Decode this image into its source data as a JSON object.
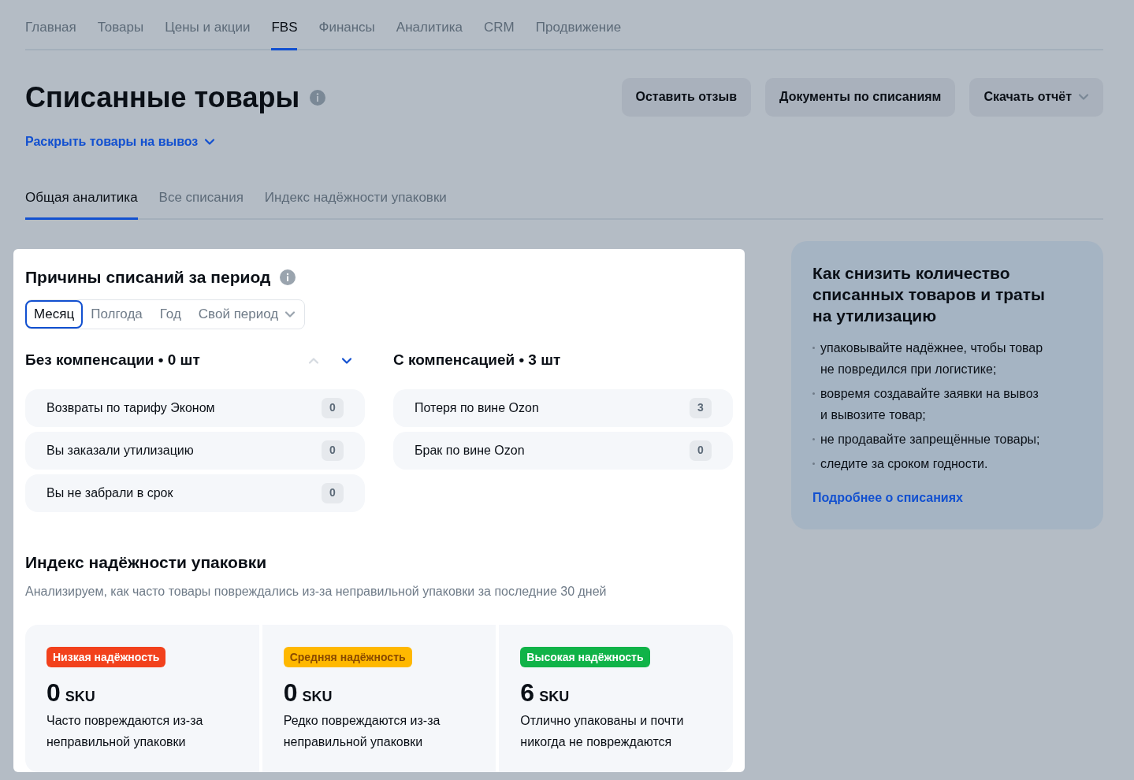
{
  "nav": [
    {
      "label": "Главная",
      "selected": false
    },
    {
      "label": "Товары",
      "selected": false
    },
    {
      "label": "Цены и акции",
      "selected": false
    },
    {
      "label": "FBS",
      "selected": true
    },
    {
      "label": "Финансы",
      "selected": false
    },
    {
      "label": "Аналитика",
      "selected": false
    },
    {
      "label": "CRM",
      "selected": false
    },
    {
      "label": "Продвижение",
      "selected": false
    }
  ],
  "page": {
    "title": "Списанные товары",
    "expand_link": "Раскрыть товары на вывоз"
  },
  "actions": [
    {
      "label": "Оставить отзыв",
      "kind": "plain"
    },
    {
      "label": "Документы по списаниям",
      "kind": "plain"
    },
    {
      "label": "Скачать отчёт",
      "kind": "dropdown"
    }
  ],
  "tabs": [
    {
      "label": "Общая аналитика",
      "selected": true
    },
    {
      "label": "Все списания",
      "selected": false
    },
    {
      "label": "Индекс надёжности упаковки",
      "selected": false
    }
  ],
  "reasons": {
    "title": "Причины списаний за период",
    "periods": [
      {
        "label": "Месяц",
        "selected": true,
        "kind": "plain"
      },
      {
        "label": "Полгода",
        "selected": false,
        "kind": "plain"
      },
      {
        "label": "Год",
        "selected": false,
        "kind": "plain"
      },
      {
        "label": "Свой период",
        "selected": false,
        "kind": "dropdown"
      }
    ],
    "groups": [
      {
        "title": "Без компенсации • 0 шт",
        "pager": true,
        "items": [
          {
            "label": "Возвраты по тарифу Эконом",
            "count": "0"
          },
          {
            "label": "Вы заказали утилизацию",
            "count": "0"
          },
          {
            "label": "Вы не забрали в срок",
            "count": "0"
          }
        ]
      },
      {
        "title": "С компенсацией • 3 шт",
        "pager": false,
        "items": [
          {
            "label": "Потеря по вине Ozon",
            "count": "3"
          },
          {
            "label": "Брак по вине Ozon",
            "count": "0"
          }
        ]
      }
    ]
  },
  "packaging": {
    "title": "Индекс надёжности упаковки",
    "subtitle": "Анализируем, как часто товары повреждались из-за неправильной упаковки за последние 30 дней",
    "tiers": [
      {
        "badge": "Низкая надёжность",
        "kind": "low",
        "color": "#f2411c",
        "value": "0",
        "unit": "SKU",
        "text": "Часто повреждаются из-за неправильной упаковки"
      },
      {
        "badge": "Средняя надёжность",
        "kind": "medium",
        "color": "#ffb800",
        "value": "0",
        "unit": "SKU",
        "text": "Редко повреждаются из-за неправильной упаковки"
      },
      {
        "badge": "Высокая надёжность",
        "kind": "high",
        "color": "#10b348",
        "value": "6",
        "unit": "SKU",
        "text": "Отлично упакованы и почти никогда не повреждаются"
      }
    ]
  },
  "tips": {
    "title": "Как снизить количество списанных товаров и траты на утилизацию",
    "items": [
      "упаковывайте надёжнее, чтобы товар не повредился при логистике;",
      "вовремя создавайте заявки на вывоз и вывозите товар;",
      "не продавайте запрещённые товары;",
      "следите за сроком годности."
    ],
    "link": "Подробнее о списаниях"
  }
}
